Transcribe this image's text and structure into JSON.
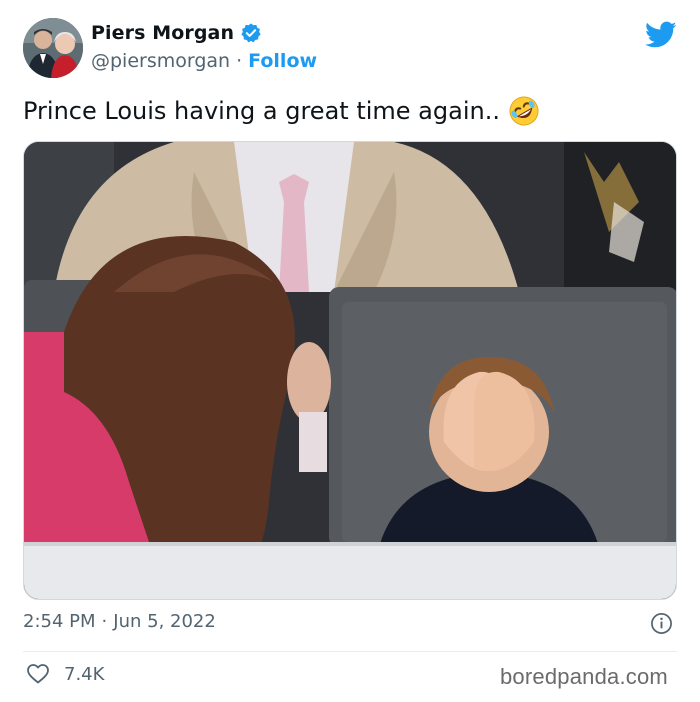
{
  "author": {
    "display_name": "Piers Morgan",
    "handle": "@piersmorgan",
    "separator": "·",
    "follow_label": "Follow",
    "verified": true
  },
  "tweet": {
    "text": "Prince Louis having a great time again..",
    "emoji": "rolling-on-the-floor-laughing",
    "time": "2:54 PM",
    "meta_separator": "·",
    "date": "Jun 5, 2022"
  },
  "engagement": {
    "likes": "7.4K"
  },
  "watermark": "boredpanda.com",
  "icons": {
    "brand": "twitter-bird-icon",
    "verified": "verified-badge-icon",
    "info": "info-icon",
    "like": "heart-icon"
  },
  "colors": {
    "accent": "#1d9bf0",
    "text_primary": "#0f1419",
    "text_secondary": "#536471",
    "border": "#cfd9de"
  }
}
